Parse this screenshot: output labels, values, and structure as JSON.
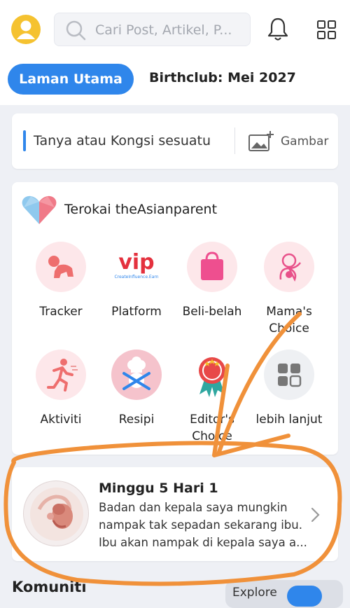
{
  "header": {
    "search_placeholder": "Cari Post, Artikel, P...",
    "tabs": [
      {
        "label": "Laman Utama",
        "active": true
      },
      {
        "label": "Birthclub: Mei 2027",
        "active": false
      }
    ]
  },
  "ask": {
    "prompt": "Tanya atau Kongsi sesuatu",
    "image_label": "Gambar"
  },
  "explore": {
    "title": "Terokai theAsianparent",
    "features": [
      {
        "label": "Tracker",
        "icon": "baby-crawl-icon"
      },
      {
        "label": "Platform",
        "icon": "vip-icon"
      },
      {
        "label": "Beli-belah",
        "icon": "shopping-bag-icon"
      },
      {
        "label": "Mama's Choice",
        "icon": "mamas-choice-icon"
      },
      {
        "label": "Aktiviti",
        "icon": "running-icon"
      },
      {
        "label": "Resipi",
        "icon": "chef-icon"
      },
      {
        "label": "Editor's Choice",
        "icon": "editor-badge-icon"
      },
      {
        "label": "lebih lanjut",
        "icon": "more-grid-icon"
      }
    ],
    "vip_text": "vip",
    "vip_sub": "CreateInfluence.Earn"
  },
  "pregnancy": {
    "title": "Minggu 5 Hari 1",
    "description": "Badan dan kepala saya mungkin nampak tak sepadan sekarang ibu. Ibu akan nampak di kepala saya a..."
  },
  "bottom": {
    "title": "Komuniti",
    "pill": "Explore"
  },
  "colors": {
    "accent": "#2f86eb",
    "annotation": "#f0913a",
    "avatar": "#f5c230",
    "pink": "#ef5a8a"
  }
}
